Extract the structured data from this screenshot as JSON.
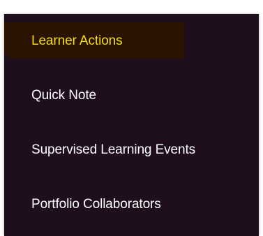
{
  "menu": {
    "items": [
      {
        "label": "Learner Actions",
        "active": true
      },
      {
        "label": "Quick Note",
        "active": false
      },
      {
        "label": "Supervised Learning Events",
        "active": false
      },
      {
        "label": "Portfolio Collaborators",
        "active": false
      }
    ]
  },
  "colors": {
    "panel_background": "#1e0e1e",
    "active_background": "#2a1300",
    "active_text": "#f4df0c",
    "text": "#ffffff"
  }
}
